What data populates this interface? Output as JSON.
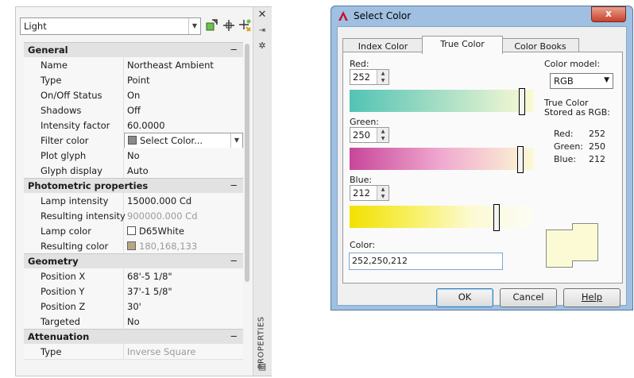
{
  "properties_palette": {
    "object_type": "Light",
    "sidebar_title": "PROPERTIES",
    "sections": [
      {
        "title": "General",
        "collapse": "−",
        "rows": [
          {
            "label": "Name",
            "value": "Northeast Ambient"
          },
          {
            "label": "Type",
            "value": "Point"
          },
          {
            "label": "On/Off Status",
            "value": "On"
          },
          {
            "label": "Shadows",
            "value": "Off"
          },
          {
            "label": "Intensity factor",
            "value": "60.0000"
          },
          {
            "label": "Filter color",
            "value": "Select Color..."
          },
          {
            "label": "Plot glyph",
            "value": "No"
          },
          {
            "label": "Glyph display",
            "value": "Auto"
          }
        ]
      },
      {
        "title": "Photometric properties",
        "collapse": "−",
        "rows": [
          {
            "label": "Lamp intensity",
            "value": "15000.000 Cd"
          },
          {
            "label": "Resulting intensity",
            "value": "900000.000 Cd"
          },
          {
            "label": "Lamp color",
            "value": "D65White"
          },
          {
            "label": "Resulting color",
            "value": "180,168,133"
          }
        ]
      },
      {
        "title": "Geometry",
        "collapse": "−",
        "rows": [
          {
            "label": "Position X",
            "value": "68'-5 1/8\""
          },
          {
            "label": "Position Y",
            "value": "37'-1 5/8\""
          },
          {
            "label": "Position Z",
            "value": "30'"
          },
          {
            "label": "Targeted",
            "value": "No"
          }
        ]
      },
      {
        "title": "Attenuation",
        "collapse": "−",
        "rows": [
          {
            "label": "Type",
            "value": "Inverse Square"
          }
        ]
      }
    ],
    "colors": {
      "resulting_color": "#b4a885",
      "filter_swatch": "#8a8a8a"
    }
  },
  "select_color_dialog": {
    "title": "Select Color",
    "close": "x",
    "tabs": [
      "Index Color",
      "True Color",
      "Color Books"
    ],
    "active_tab": "True Color",
    "red_label": "Red:",
    "red_value": "252",
    "green_label": "Green:",
    "green_value": "250",
    "blue_label": "Blue:",
    "blue_value": "212",
    "color_model_label": "Color model:",
    "color_model_value": "RGB",
    "stored_label": "True Color Stored as RGB:",
    "stored": [
      {
        "name": "Red:",
        "value": "252"
      },
      {
        "name": "Green:",
        "value": "250"
      },
      {
        "name": "Blue:",
        "value": "212"
      }
    ],
    "color_label": "Color:",
    "color_value": "252,250,212",
    "buttons": {
      "ok": "OK",
      "cancel": "Cancel",
      "help": "Help"
    },
    "swatch_color": "#fcfad4",
    "slider_levels": {
      "red": 252,
      "green": 250,
      "blue": 212,
      "max": 255
    }
  }
}
